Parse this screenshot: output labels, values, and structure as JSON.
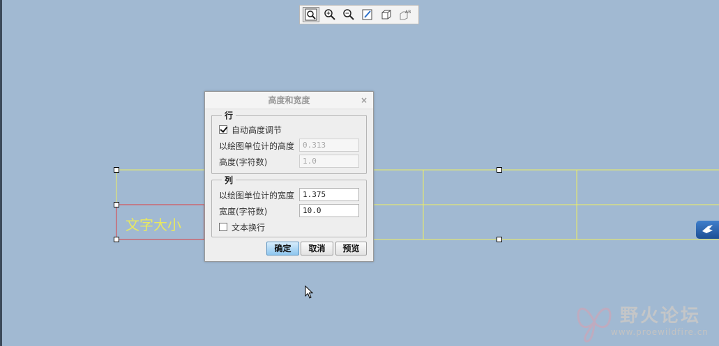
{
  "toolbar": {
    "items": [
      "zoom-fit-icon",
      "zoom-in-icon",
      "zoom-out-icon",
      "repaint-icon",
      "display-style-icon",
      "annotation-display-icon"
    ]
  },
  "drawing": {
    "cell_text": "文字大小",
    "line_color": "#f0f060",
    "text_color": "#e8e860",
    "highlight_color": "#e04040"
  },
  "dialog": {
    "title": "高度和宽度",
    "close_glyph": "×",
    "row_group": {
      "title": "行",
      "auto_height_label": "自动高度调节",
      "auto_height_checked": true,
      "height_drawing_units_label": "以绘图单位计的高度",
      "height_drawing_units_value": "0.313",
      "height_chars_label": "高度(字符数)",
      "height_chars_value": "1.0"
    },
    "col_group": {
      "title": "列",
      "width_drawing_units_label": "以绘图单位计的宽度",
      "width_drawing_units_value": "1.375",
      "width_chars_label": "宽度(字符数)",
      "width_chars_value": "10.0",
      "text_wrap_label": "文本换行",
      "text_wrap_checked": false
    },
    "buttons": {
      "ok": "确定",
      "cancel": "取消",
      "preview": "预览"
    }
  },
  "watermark": {
    "text": "野火论坛",
    "url": "www.proewildfire.cn"
  }
}
